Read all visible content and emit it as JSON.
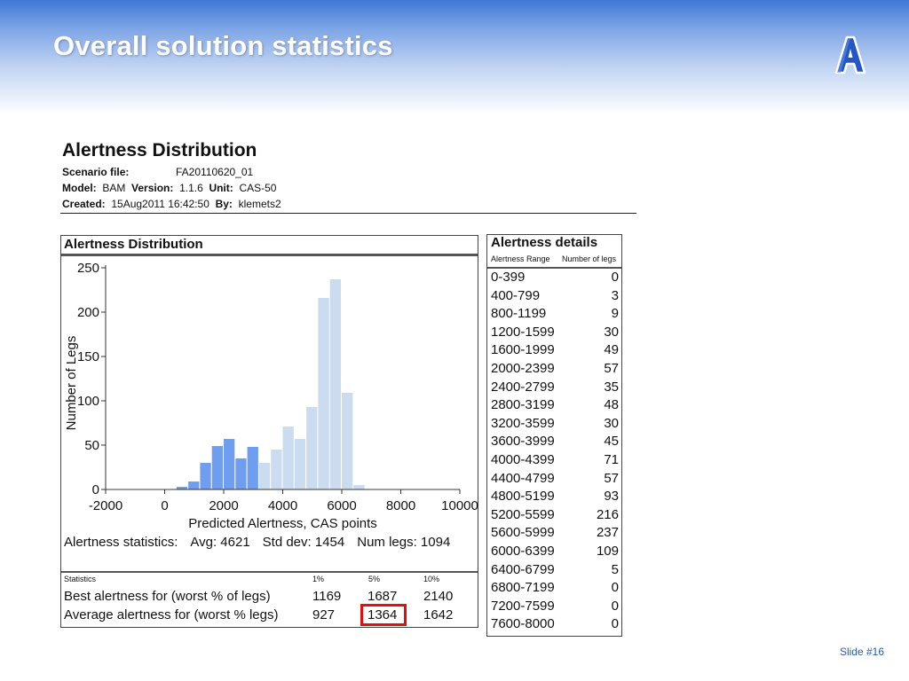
{
  "slide": {
    "title": "Overall solution statistics",
    "logo_letter": "A",
    "number": "Slide #16"
  },
  "report": {
    "title": "Alertness Distribution",
    "scenario_label": "Scenario file:",
    "scenario_value": "FA20110620_01",
    "model_label": "Model:",
    "model_value": "BAM",
    "version_label": "Version:",
    "version_value": "1.1.6",
    "unit_label": "Unit:",
    "unit_value": "CAS-50",
    "created_label": "Created:",
    "created_value": "15Aug2011 16:42:50",
    "by_label": "By:",
    "by_value": "klemets2"
  },
  "panel": {
    "title": "Alertness Distribution"
  },
  "stats": {
    "label": "Alertness statistics:",
    "avg": "Avg: 4621",
    "std": "Std dev: 1454",
    "legs": "Num legs: 1094"
  },
  "worst_table": {
    "header": [
      "Statistics",
      "1%",
      "5%",
      "10%"
    ],
    "rows": [
      {
        "label": "Best alertness for (worst % of legs)",
        "values": [
          "1169",
          "1687",
          "2140"
        ]
      },
      {
        "label": "Average alertness for (worst % legs)",
        "values": [
          "927",
          "1364",
          "1642"
        ]
      }
    ],
    "highlight_color": "#e01010"
  },
  "details": {
    "title": "Alertness details",
    "col_range": "Alertness Range",
    "col_count": "Number of legs",
    "rows": [
      {
        "range": "0-399",
        "count": "0"
      },
      {
        "range": "400-799",
        "count": "3"
      },
      {
        "range": "800-1199",
        "count": "9"
      },
      {
        "range": "1200-1599",
        "count": "30"
      },
      {
        "range": "1600-1999",
        "count": "49"
      },
      {
        "range": "2000-2399",
        "count": "57"
      },
      {
        "range": "2400-2799",
        "count": "35"
      },
      {
        "range": "2800-3199",
        "count": "48"
      },
      {
        "range": "3200-3599",
        "count": "30"
      },
      {
        "range": "3600-3999",
        "count": "45"
      },
      {
        "range": "4000-4399",
        "count": "71"
      },
      {
        "range": "4400-4799",
        "count": "57"
      },
      {
        "range": "4800-5199",
        "count": "93"
      },
      {
        "range": "5200-5599",
        "count": "216"
      },
      {
        "range": "5600-5999",
        "count": "237"
      },
      {
        "range": "6000-6399",
        "count": "109"
      },
      {
        "range": "6400-6799",
        "count": "5"
      },
      {
        "range": "6800-7199",
        "count": "0"
      },
      {
        "range": "7200-7599",
        "count": "0"
      },
      {
        "range": "7600-8000",
        "count": "0"
      }
    ]
  },
  "chart_data": {
    "type": "bar",
    "xlabel": "Predicted Alertness, CAS points",
    "ylabel": "Number of Legs",
    "xlim": [
      -2000,
      10000
    ],
    "ylim": [
      0,
      250
    ],
    "x_ticks": [
      "-2000",
      "0",
      "2000",
      "4000",
      "6000",
      "8000",
      "10000"
    ],
    "y_ticks": [
      "0",
      "50",
      "100",
      "150",
      "200",
      "250"
    ],
    "bin_width": 400,
    "bin_starts": [
      0,
      400,
      800,
      1200,
      1600,
      2000,
      2400,
      2800,
      3200,
      3600,
      4000,
      4400,
      4800,
      5200,
      5600,
      6000,
      6400,
      6800,
      7200,
      7600
    ],
    "values": [
      0,
      3,
      9,
      30,
      49,
      57,
      35,
      48,
      30,
      45,
      71,
      57,
      93,
      216,
      237,
      109,
      5,
      0,
      0,
      0
    ],
    "color_low": "#6f9ef0",
    "color_high": "#cbdcf0",
    "color_split_at": 3200
  }
}
